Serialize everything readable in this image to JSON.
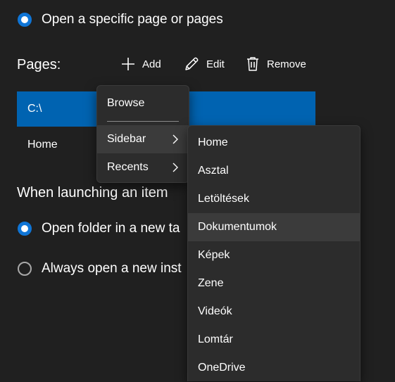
{
  "startup": {
    "open_specific_label": "Open a specific page or pages"
  },
  "pages": {
    "heading": "Pages:",
    "toolbar": {
      "add_label": "Add",
      "edit_label": "Edit",
      "remove_label": "Remove"
    },
    "list": [
      "C:\\",
      "Home"
    ]
  },
  "launch": {
    "heading": "When launching an item",
    "option_new_tab": "Open folder in a new ta",
    "option_new_instance": "Always open a new inst"
  },
  "context_menu": {
    "browse": "Browse",
    "sidebar": "Sidebar",
    "recents": "Recents"
  },
  "submenu": {
    "items": [
      "Home",
      "Asztal",
      "Letöltések",
      "Dokumentumok",
      "Képek",
      "Zene",
      "Videók",
      "Lomtár",
      "OneDrive"
    ],
    "highlighted": "Dokumentumok"
  },
  "colors": {
    "background": "#202020",
    "accent": "#0f75d6",
    "selection": "#0063b1",
    "menu_background": "#2c2c2c",
    "menu_hover": "#3b3b3b"
  }
}
